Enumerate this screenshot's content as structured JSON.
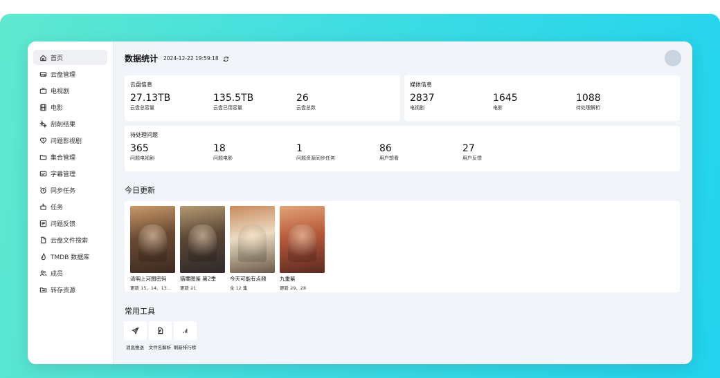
{
  "sidebar": {
    "items": [
      {
        "label": "首页",
        "icon": "home-icon",
        "active": true
      },
      {
        "label": "云盘管理",
        "icon": "drive-icon"
      },
      {
        "label": "电视剧",
        "icon": "tv-icon"
      },
      {
        "label": "电影",
        "icon": "film-icon"
      },
      {
        "label": "刮削结果",
        "icon": "sparkle-icon"
      },
      {
        "label": "问题影视剧",
        "icon": "heart-alert-icon"
      },
      {
        "label": "集合管理",
        "icon": "folder-icon"
      },
      {
        "label": "字幕管理",
        "icon": "subtitle-icon"
      },
      {
        "label": "同步任务",
        "icon": "alarm-icon"
      },
      {
        "label": "任务",
        "icon": "robot-icon"
      },
      {
        "label": "问题反馈",
        "icon": "feedback-icon"
      },
      {
        "label": "云盘文件搜索",
        "icon": "file-icon"
      },
      {
        "label": "TMDB 数据库",
        "icon": "flame-icon"
      },
      {
        "label": "成员",
        "icon": "users-icon"
      },
      {
        "label": "转存资源",
        "icon": "folder-transfer-icon"
      }
    ]
  },
  "header": {
    "title": "数据统计",
    "timestamp": "2024-12-22 19:59:18"
  },
  "cloud_info": {
    "title": "云盘信息",
    "stats": [
      {
        "value": "27.13TB",
        "label": "云盘总容量"
      },
      {
        "value": "135.5TB",
        "label": "云盘已用容量"
      },
      {
        "value": "26",
        "label": "云盘总数"
      }
    ]
  },
  "media_info": {
    "title": "媒体信息",
    "stats": [
      {
        "value": "2837",
        "label": "电视剧"
      },
      {
        "value": "1645",
        "label": "电影"
      },
      {
        "value": "1088",
        "label": "待处理解析"
      }
    ]
  },
  "pending": {
    "title": "待处理问题",
    "stats": [
      {
        "value": "365",
        "label": "问题电视剧"
      },
      {
        "value": "18",
        "label": "问题电影"
      },
      {
        "value": "1",
        "label": "问题资源同步任务"
      },
      {
        "value": "86",
        "label": "用户想看"
      },
      {
        "value": "27",
        "label": "用户反馈"
      }
    ]
  },
  "today": {
    "title": "今日更新",
    "items": [
      {
        "name": "清明上河图密码",
        "episodes": "更新 15、14、13...",
        "colors": [
          "#6b4a32",
          "#c89a6a",
          "#3c2b22"
        ]
      },
      {
        "name": "猎罪图鉴 第2季",
        "episodes": "更新 21",
        "colors": [
          "#5a4636",
          "#b59a72",
          "#2f2a2a"
        ]
      },
      {
        "name": "今天可能有点频",
        "episodes": "全 12 集",
        "colors": [
          "#e9dcc2",
          "#c98a5e",
          "#6c5a48"
        ]
      },
      {
        "name": "九重紫",
        "episodes": "更新 29、28",
        "colors": [
          "#b8583a",
          "#e2a47a",
          "#5a2a22"
        ]
      }
    ]
  },
  "tools": {
    "title": "常用工具",
    "items": [
      {
        "label": "消息推送",
        "icon": "send-icon"
      },
      {
        "label": "文件名解析",
        "icon": "file-parse-icon"
      },
      {
        "label": "刷新排行榜",
        "icon": "bar-chart-icon"
      }
    ]
  }
}
